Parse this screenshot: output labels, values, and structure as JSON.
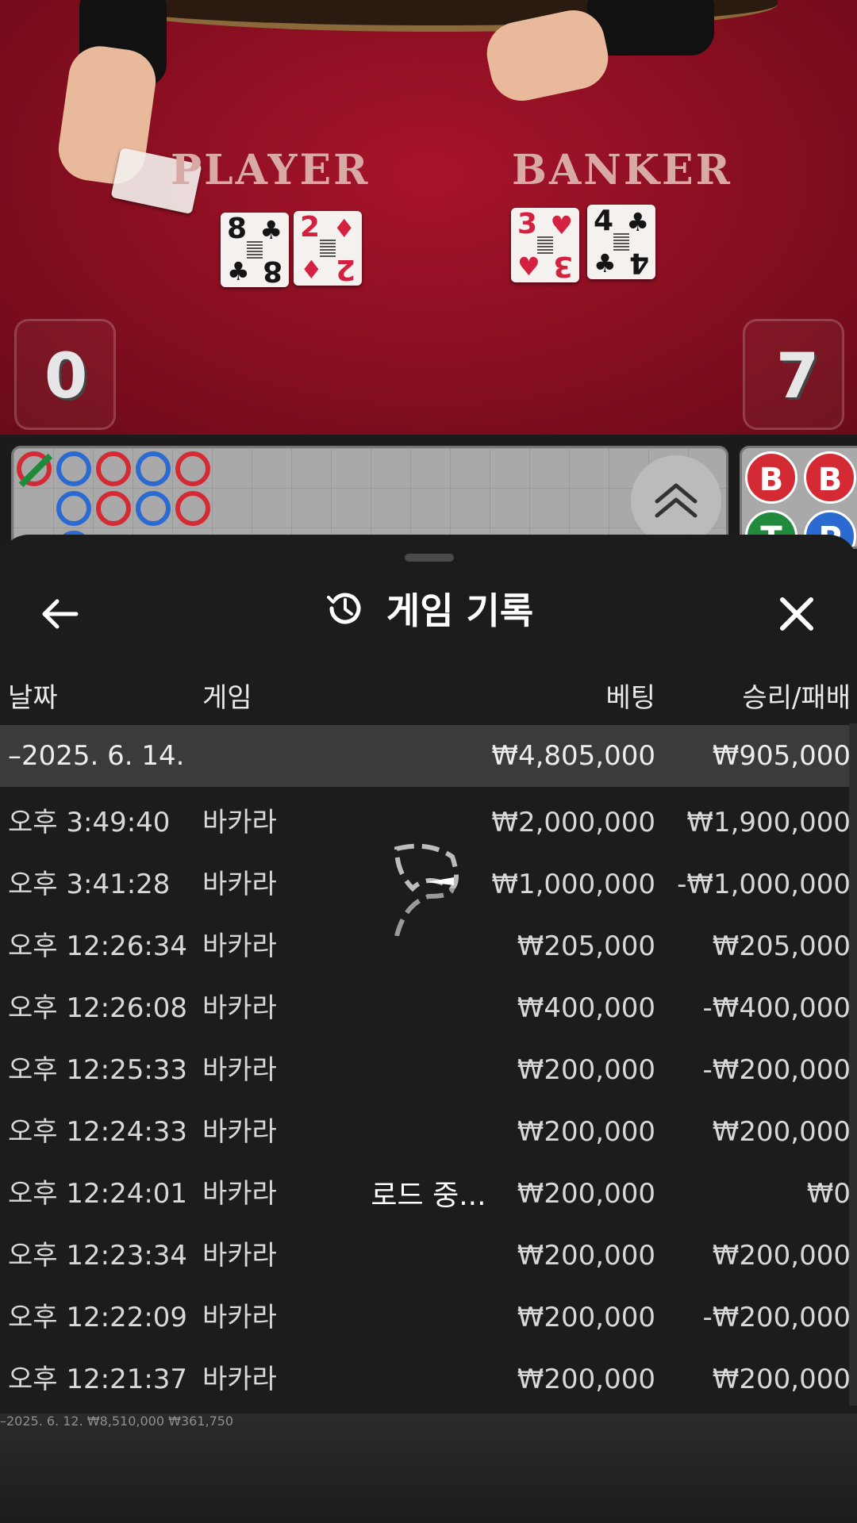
{
  "table": {
    "player_label": "PLAYER",
    "banker_label": "BANKER",
    "player_score": "0",
    "banker_score": "7",
    "player_cards": [
      {
        "rank": "8",
        "suit": "♣",
        "color": "#151515"
      },
      {
        "rank": "2",
        "suit": "♦",
        "color": "#d3213f"
      }
    ],
    "banker_cards": [
      {
        "rank": "3",
        "suit": "♥",
        "color": "#d3213f"
      },
      {
        "rank": "4",
        "suit": "♣",
        "color": "#151515"
      }
    ]
  },
  "roadmap": {
    "discs": [
      "B",
      "B",
      "T",
      "P"
    ],
    "expand_icon": "chevron-double-up-icon"
  },
  "sheet": {
    "title": "게임 기록",
    "title_icon": "history-icon",
    "back_icon": "arrow-left-icon",
    "close_icon": "close-icon",
    "columns": {
      "date": "날짜",
      "game": "게임",
      "bet": "베팅",
      "win_loss": "승리/패배"
    },
    "groups": [
      {
        "date": "–2025. 6. 14.",
        "bet": "₩4,805,000",
        "win_loss": "₩905,000",
        "rows": [
          {
            "time": "오후 3:49:40",
            "game": "바카라",
            "bet": "₩2,000,000",
            "win_loss": "₩1,900,000"
          },
          {
            "time": "오후 3:41:28",
            "game": "바카라",
            "bet": "₩1,000,000",
            "win_loss": "-₩1,000,000"
          },
          {
            "time": "오후 12:26:34",
            "game": "바카라",
            "bet": "₩205,000",
            "win_loss": "₩205,000"
          },
          {
            "time": "오후 12:26:08",
            "game": "바카라",
            "bet": "₩400,000",
            "win_loss": "-₩400,000"
          },
          {
            "time": "오후 12:25:33",
            "game": "바카라",
            "bet": "₩200,000",
            "win_loss": "-₩200,000"
          },
          {
            "time": "오후 12:24:33",
            "game": "바카라",
            "bet": "₩200,000",
            "win_loss": "₩200,000"
          },
          {
            "time": "오후 12:24:01",
            "game": "바카라",
            "bet": "₩200,000",
            "win_loss": "₩0"
          },
          {
            "time": "오후 12:23:34",
            "game": "바카라",
            "bet": "₩200,000",
            "win_loss": "₩200,000"
          },
          {
            "time": "오후 12:22:09",
            "game": "바카라",
            "bet": "₩200,000",
            "win_loss": "-₩200,000"
          },
          {
            "time": "오후 12:21:37",
            "game": "바카라",
            "bet": "₩200,000",
            "win_loss": "₩200,000"
          }
        ]
      },
      {
        "date": "–2025. 6. 12.",
        "bet": "₩8,510,000",
        "win_loss": "₩361,750",
        "rows": []
      }
    ],
    "loading_text": "로드 중..."
  }
}
